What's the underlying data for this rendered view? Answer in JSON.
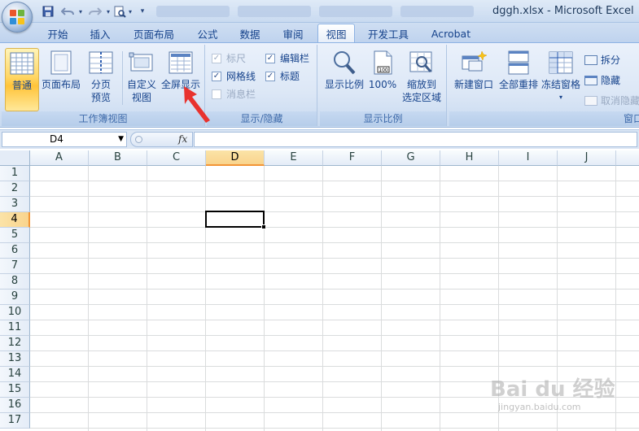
{
  "window": {
    "title": "dggh.xlsx - Microsoft Excel"
  },
  "quick_access": {
    "save_icon": "save-icon",
    "undo_icon": "undo-icon",
    "redo_icon": "redo-icon",
    "print_preview_icon": "print-preview-icon"
  },
  "ribbon_tabs": [
    "开始",
    "插入",
    "页面布局",
    "公式",
    "数据",
    "审阅",
    "视图",
    "开发工具",
    "Acrobat"
  ],
  "active_tab": "视图",
  "groups": {
    "workbook_views": {
      "label": "工作簿视图",
      "normal": "普通",
      "page_layout": "页面布局",
      "page_break_1": "分页",
      "page_break_2": "预览",
      "custom_views_1": "自定义",
      "custom_views_2": "视图",
      "full_screen": "全屏显示"
    },
    "show_hide": {
      "label": "显示/隐藏",
      "ruler": "标尺",
      "gridlines": "网格线",
      "message_bar": "消息栏",
      "formula_bar": "编辑栏",
      "headings": "标题",
      "ruler_checked": true,
      "gridlines_checked": true,
      "message_bar_checked": false,
      "formula_bar_checked": true,
      "headings_checked": true
    },
    "zoom": {
      "label": "显示比例",
      "zoom": "显示比例",
      "hundred": "100%",
      "selection_1": "缩放到",
      "selection_2": "选定区域"
    },
    "window": {
      "label": "窗口",
      "new_window": "新建窗口",
      "arrange_all": "全部重排",
      "freeze_panes": "冻结窗格",
      "split": "拆分",
      "hide": "隐藏",
      "unhide": "取消隐藏"
    }
  },
  "formula_bar": {
    "name_box": "D4",
    "fx": "fx",
    "formula": ""
  },
  "grid": {
    "columns": [
      "A",
      "B",
      "C",
      "D",
      "E",
      "F",
      "G",
      "H",
      "I",
      "J"
    ],
    "rows": [
      "1",
      "2",
      "3",
      "4",
      "5",
      "6",
      "7",
      "8",
      "9",
      "10",
      "11",
      "12",
      "13",
      "14",
      "15",
      "16",
      "17"
    ],
    "active_column": "D",
    "active_row": "4"
  },
  "watermark": {
    "text": "Bai du 经验",
    "sub": "jingyan.baidu.com"
  },
  "colors": {
    "ribbon_bg": "#dce7f6",
    "active_button": "#ffd766",
    "grid_line": "#dadcdd",
    "arrow": "#e8322e"
  }
}
